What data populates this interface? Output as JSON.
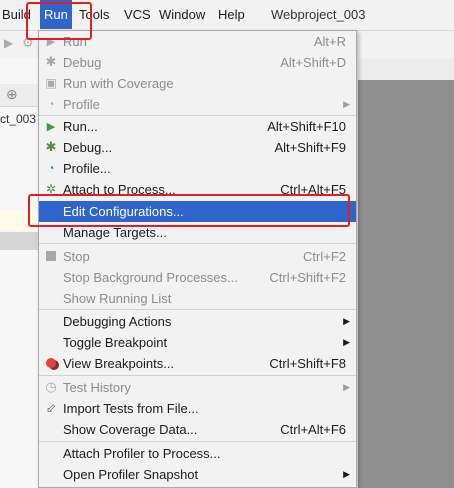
{
  "menubar": {
    "items": [
      "Build",
      "Run",
      "Tools",
      "VCS",
      "Window",
      "Help"
    ],
    "project_title": "Webproject_003"
  },
  "sidebar": {
    "project_label": "ct_003"
  },
  "menu": {
    "items": [
      {
        "label": "Run",
        "shortcut": "Alt+R",
        "disabled": true,
        "icon": "run-icon"
      },
      {
        "label": "Debug",
        "shortcut": "Alt+Shift+D",
        "disabled": true,
        "icon": "debug-icon"
      },
      {
        "label": "Run with Coverage",
        "shortcut": "",
        "disabled": true,
        "icon": "coverage-icon"
      },
      {
        "label": "Profile",
        "shortcut": "",
        "disabled": true,
        "submenu": true,
        "icon": "profile-icon"
      },
      {
        "label": "Run...",
        "shortcut": "Alt+Shift+F10",
        "icon": "run-icon"
      },
      {
        "label": "Debug...",
        "shortcut": "Alt+Shift+F9",
        "icon": "debug-icon"
      },
      {
        "label": "Profile...",
        "shortcut": "",
        "icon": "profile-icon"
      },
      {
        "label": "Attach to Process...",
        "shortcut": "Ctrl+Alt+F5",
        "icon": "attach-icon"
      },
      {
        "label": "Edit Configurations...",
        "shortcut": "",
        "selected": true
      },
      {
        "label": "Manage Targets...",
        "shortcut": ""
      },
      {
        "label": "Stop",
        "shortcut": "Ctrl+F2",
        "disabled": true,
        "icon": "stop-icon"
      },
      {
        "label": "Stop Background Processes...",
        "shortcut": "Ctrl+Shift+F2",
        "disabled": true
      },
      {
        "label": "Show Running List",
        "shortcut": "",
        "disabled": true
      },
      {
        "label": "Debugging Actions",
        "shortcut": "",
        "submenu": true
      },
      {
        "label": "Toggle Breakpoint",
        "shortcut": "",
        "submenu": true
      },
      {
        "label": "View Breakpoints...",
        "shortcut": "Ctrl+Shift+F8",
        "icon": "breakpoints-icon"
      },
      {
        "label": "Test History",
        "shortcut": "",
        "disabled": true,
        "submenu": true,
        "icon": "history-icon"
      },
      {
        "label": "Import Tests from File...",
        "shortcut": "",
        "icon": "import-icon"
      },
      {
        "label": "Show Coverage Data...",
        "shortcut": "Ctrl+Alt+F6"
      },
      {
        "label": "Attach Profiler to Process...",
        "shortcut": ""
      },
      {
        "label": "Open Profiler Snapshot",
        "shortcut": "",
        "submenu": true
      }
    ]
  },
  "colors": {
    "highlight": "#2f65ca",
    "annotation": "#e02020",
    "run_green": "#3d9a3d",
    "debug_green": "#4f8f3c",
    "breakpoint_red": "#e0443e"
  }
}
